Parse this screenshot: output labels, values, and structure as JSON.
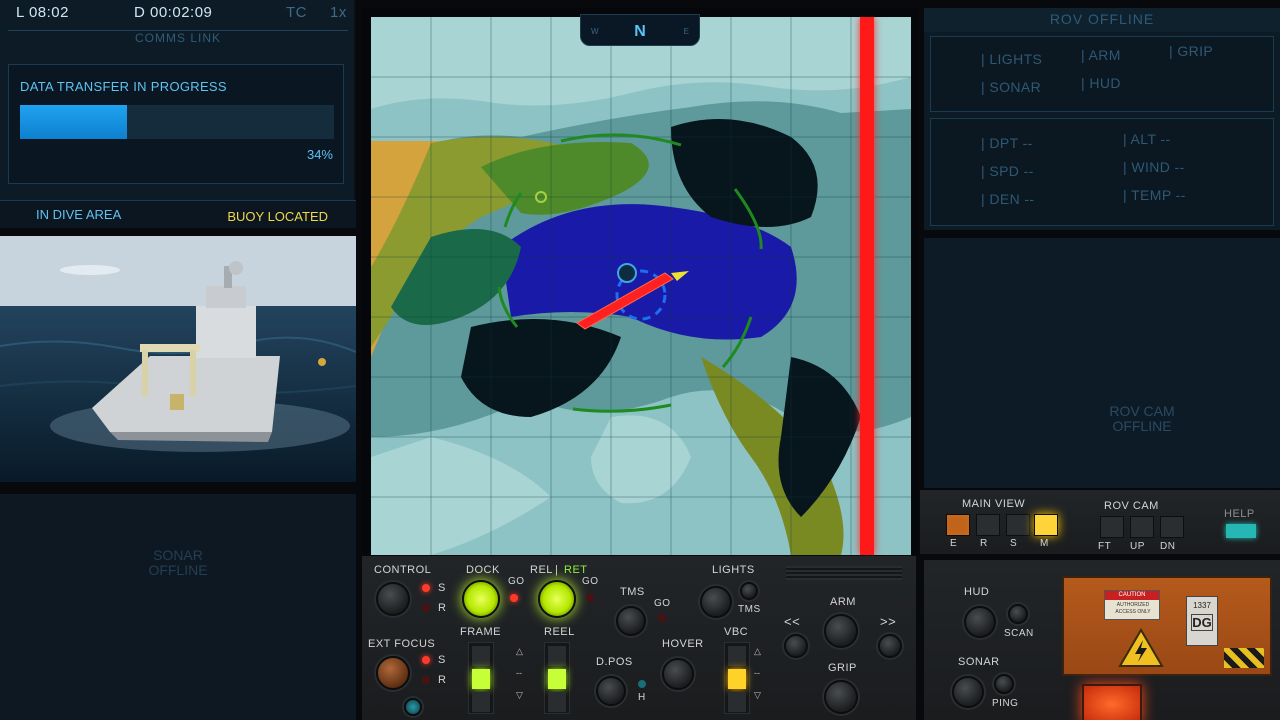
{
  "topbar": {
    "local_time": "L 08:02",
    "dive_time": "D 00:02:09",
    "time_compression": "TC",
    "speed": "1x"
  },
  "comms": {
    "title": "COMMS LINK",
    "transfer_label": "DATA TRANSFER IN PROGRESS",
    "progress_text": "34%",
    "progress_fraction": 0.34,
    "status_left": "IN DIVE AREA",
    "status_right": "BUOY LOCATED"
  },
  "sonar_panel": {
    "line1": "SONAR",
    "line2": "OFFLINE"
  },
  "map": {
    "heading": "N",
    "compass_west": "W",
    "compass_east": "E"
  },
  "rov": {
    "title": "ROV OFFLINE",
    "systems": [
      "| LIGHTS",
      "| ARM",
      "| GRIP",
      "| SONAR",
      "| HUD"
    ],
    "readouts": [
      "| DPT --",
      "| ALT --",
      "| SPD --",
      "| WIND --",
      "| DEN --",
      "| TEMP --"
    ],
    "cam_line1": "ROV CAM",
    "cam_line2": "OFFLINE"
  },
  "main_view": {
    "title": "MAIN VIEW",
    "buttons": [
      "E",
      "R",
      "S",
      "M"
    ],
    "rov_cam_title": "ROV CAM",
    "rov_cam_buttons": [
      "FT",
      "UP",
      "DN"
    ],
    "help": "HELP"
  },
  "control_panel": {
    "control": "CONTROL",
    "s": "S",
    "r": "R",
    "dock": "DOCK",
    "go": "GO",
    "rel": "REL",
    "sep": "|",
    "ret": "RET",
    "lights": "LIGHTS",
    "tms": "TMS",
    "ext_focus": "EXT FOCUS",
    "frame": "FRAME",
    "reel": "REEL",
    "dpos": "D.POS",
    "h": "H",
    "hover": "HOVER",
    "vbc": "VBC",
    "arm": "ARM",
    "grip": "GRIP",
    "prev": "<<",
    "next": ">>",
    "dash": "--",
    "up": "△",
    "down": "▽"
  },
  "rov_panel": {
    "hud": "HUD",
    "scan": "SCAN",
    "sonar": "SONAR",
    "ping": "PING",
    "caution": "CAUTION",
    "authorized": "AUTHORIZED ACCESS ONLY",
    "tag_number": "1337",
    "tag_code": "DG"
  },
  "colors": {
    "accent_blue": "#1fa3f0",
    "buoy_yellow": "#f0d84a",
    "lit_green": "#c6ff38",
    "track_red": "#ff1a1a"
  }
}
